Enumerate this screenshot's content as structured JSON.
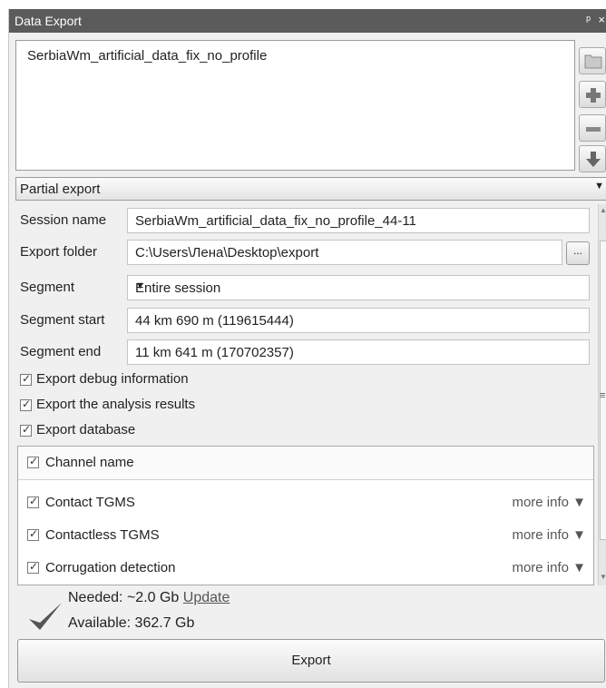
{
  "window": {
    "title": "Data Export",
    "pin_glyph": "ᵖ",
    "close_glyph": "×"
  },
  "sessions": {
    "items": [
      "SerbiaWm_artificial_data_fix_no_profile"
    ]
  },
  "side_buttons": [
    "folder-icon",
    "plus-icon",
    "minus-icon",
    "download-arrow-icon"
  ],
  "export_mode": {
    "selected": "Partial export"
  },
  "form": {
    "session_name": {
      "label": "Session name",
      "value": "SerbiaWm_artificial_data_fix_no_profile_44-11"
    },
    "export_folder": {
      "label": "Export folder",
      "value": "C:\\Users\\Лена\\Desktop\\export",
      "browse_label": "..."
    },
    "segment": {
      "label": "Segment",
      "value": "Entire session"
    },
    "segment_start": {
      "label": "Segment start",
      "value": "44 km 690 m (119615444)"
    },
    "segment_end": {
      "label": "Segment end",
      "value": "11 km 641 m (170702357)"
    }
  },
  "options": [
    {
      "label": "Export debug information",
      "checked": true
    },
    {
      "label": "Export the analysis results",
      "checked": true
    },
    {
      "label": "Export database",
      "checked": true
    }
  ],
  "channels": {
    "header": "Channel name",
    "more_label": "more info ▼",
    "rows": [
      {
        "name": "Contact TGMS",
        "checked": true
      },
      {
        "name": "Contactless TGMS",
        "checked": true
      },
      {
        "name": "Corrugation detection",
        "checked": true
      }
    ]
  },
  "space": {
    "needed_label": "Needed:",
    "needed_value": "~2.0 Gb",
    "update_link": "Update",
    "available_label": "Available:",
    "available_value": "362.7 Gb"
  },
  "export_button": "Export",
  "colors": {
    "titlebar": "#5b5b5b",
    "panel": "#f0f0f0",
    "check": "#555555"
  }
}
